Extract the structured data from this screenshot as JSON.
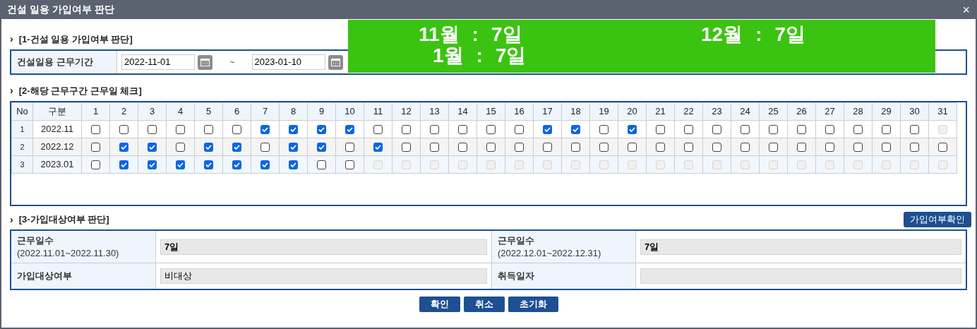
{
  "window": {
    "title": "건설 일용 가입여부 판단",
    "close": "×"
  },
  "banner": {
    "items": [
      {
        "month": "11월",
        "sep": ":",
        "value": "7일"
      },
      {
        "month": "12월",
        "sep": ":",
        "value": "7일"
      },
      {
        "month": "1월",
        "sep": ":",
        "value": "7일"
      }
    ]
  },
  "section1": {
    "marker": "›",
    "title": "[1-건설 일용 가입여부 판단]",
    "label": "건설일용 근무기간",
    "start": "2022-11-01",
    "tilde": "~",
    "end": "2023-01-10"
  },
  "section2": {
    "marker": "›",
    "title": "[2-해당 근무구간 근무일 체크]",
    "columns": [
      "No",
      "구분",
      "1",
      "2",
      "3",
      "4",
      "5",
      "6",
      "7",
      "8",
      "9",
      "10",
      "11",
      "12",
      "13",
      "14",
      "15",
      "16",
      "17",
      "18",
      "19",
      "20",
      "21",
      "22",
      "23",
      "24",
      "25",
      "26",
      "27",
      "28",
      "29",
      "30",
      "31"
    ],
    "rows": [
      {
        "no": "1",
        "month": "2022.11",
        "checked": [
          false,
          false,
          false,
          false,
          false,
          false,
          true,
          true,
          true,
          true,
          false,
          false,
          false,
          false,
          false,
          false,
          true,
          true,
          false,
          true,
          false,
          false,
          false,
          false,
          false,
          false,
          false,
          false,
          false,
          false,
          false
        ],
        "disabled": [
          false,
          false,
          false,
          false,
          false,
          false,
          false,
          false,
          false,
          false,
          false,
          false,
          false,
          false,
          false,
          false,
          false,
          false,
          false,
          false,
          false,
          false,
          false,
          false,
          false,
          false,
          false,
          false,
          false,
          false,
          true
        ]
      },
      {
        "no": "2",
        "month": "2022.12",
        "checked": [
          false,
          true,
          true,
          false,
          true,
          true,
          false,
          true,
          true,
          false,
          true,
          false,
          false,
          false,
          false,
          false,
          false,
          false,
          false,
          false,
          false,
          false,
          false,
          false,
          false,
          false,
          false,
          false,
          false,
          false,
          false
        ],
        "disabled": [
          false,
          false,
          false,
          false,
          false,
          false,
          false,
          false,
          false,
          false,
          false,
          false,
          false,
          false,
          false,
          false,
          false,
          false,
          false,
          false,
          false,
          false,
          false,
          false,
          false,
          false,
          false,
          false,
          false,
          false,
          false
        ]
      },
      {
        "no": "3",
        "month": "2023.01",
        "checked": [
          false,
          true,
          true,
          true,
          true,
          true,
          true,
          true,
          false,
          false,
          false,
          false,
          false,
          false,
          false,
          false,
          false,
          false,
          false,
          false,
          false,
          false,
          false,
          false,
          false,
          false,
          false,
          false,
          false,
          false,
          false
        ],
        "disabled": [
          false,
          false,
          false,
          false,
          false,
          false,
          false,
          false,
          false,
          false,
          true,
          true,
          true,
          true,
          true,
          true,
          true,
          true,
          true,
          true,
          true,
          true,
          true,
          true,
          true,
          true,
          true,
          true,
          true,
          true,
          true
        ]
      }
    ]
  },
  "section3": {
    "marker": "›",
    "title": "[3-가입대상여부 판단]",
    "check_button": "가입여부확인",
    "fields": [
      {
        "label": "근무일수",
        "sublabel": "(2022.11.01~2022.11.30)",
        "value": "7일"
      },
      {
        "label": "근무일수",
        "sublabel": "(2022.12.01~2022.12.31)",
        "value": "7일"
      },
      {
        "label": "가입대상여부",
        "value": "비대상"
      },
      {
        "label": "취득일자"
      }
    ]
  },
  "buttons": [
    "확인",
    "취소",
    "초기화"
  ]
}
